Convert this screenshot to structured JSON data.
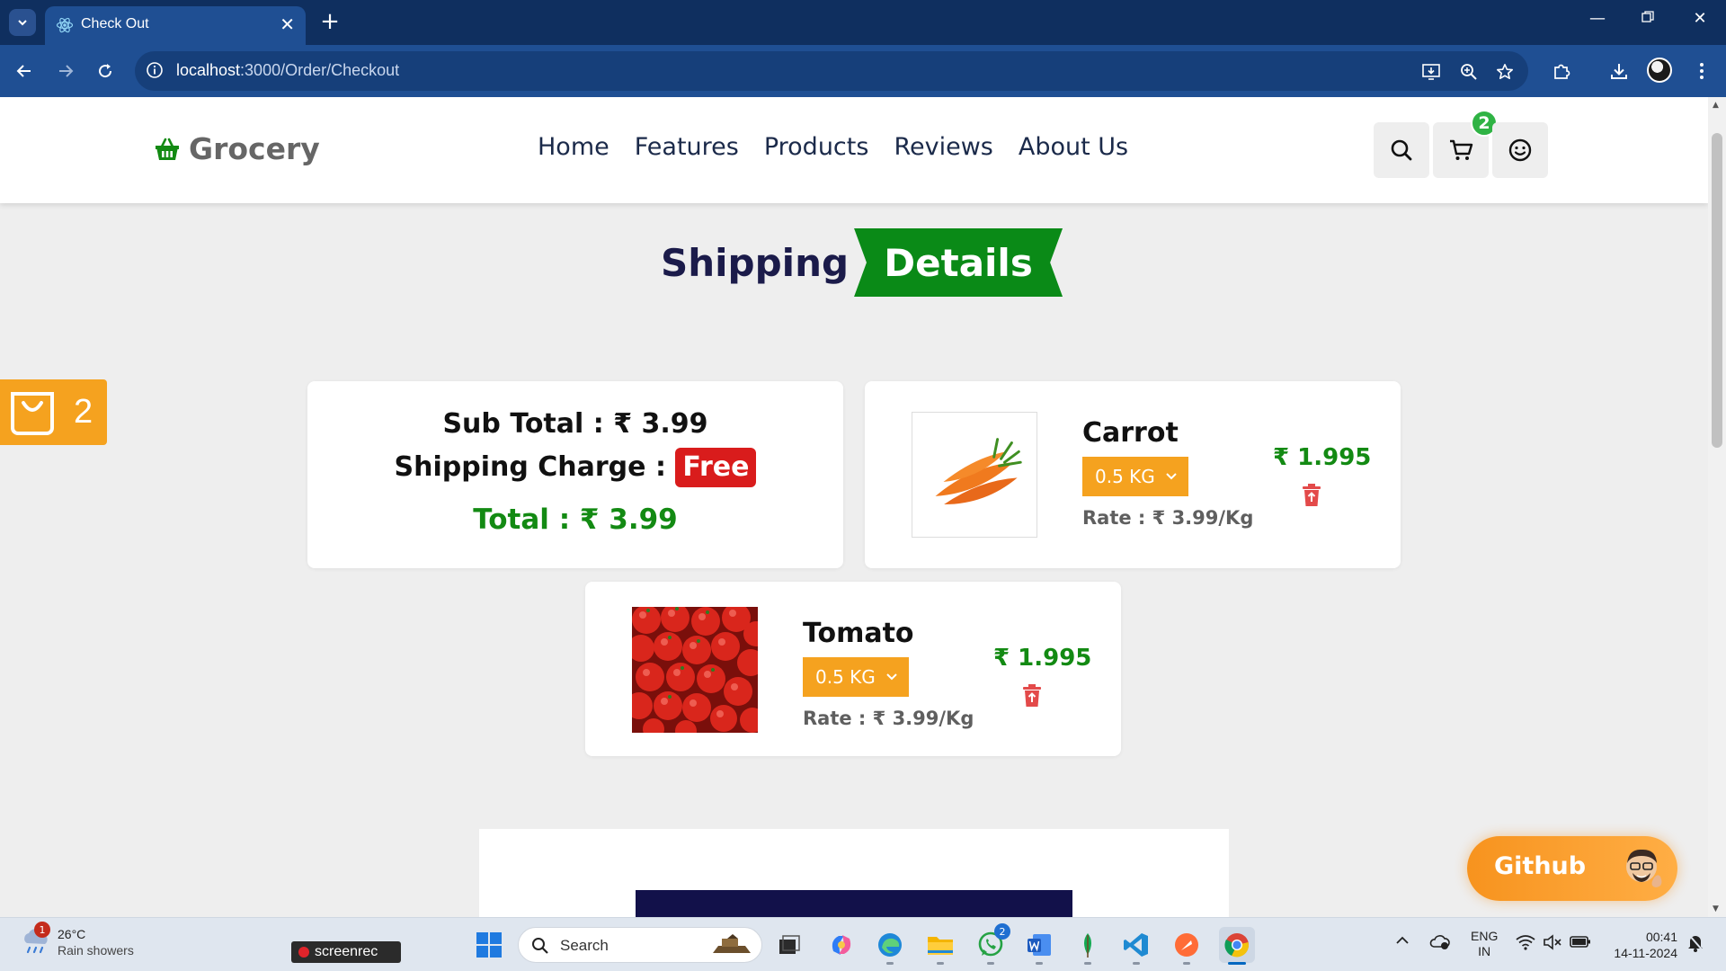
{
  "browser": {
    "tab_title": "Check Out",
    "url_host": "localhost",
    "url_path": ":3000/Order/Checkout"
  },
  "site": {
    "logo_text": "Grocery",
    "nav": [
      "Home",
      "Features",
      "Products",
      "Reviews",
      "About Us"
    ],
    "cart_count": "2",
    "side_cart_count": "2"
  },
  "heading": {
    "part1": "Shipping",
    "part2": "Details"
  },
  "summary": {
    "subtotal_label": "Sub Total : ",
    "subtotal_value": "₹ 3.99",
    "shipping_label": "Shipping Charge : ",
    "shipping_value": "Free",
    "total_label": "Total : ",
    "total_value": "₹ 3.99"
  },
  "items": [
    {
      "name": "Carrot",
      "qty": "0.5 KG",
      "rate": "Rate : ₹ 3.99/Kg",
      "price": "₹ 1.995"
    },
    {
      "name": "Tomato",
      "qty": "0.5 KG",
      "rate": "Rate : ₹ 3.99/Kg",
      "price": "₹ 1.995"
    }
  ],
  "github_label": "Github",
  "taskbar": {
    "weather_temp": "26°C",
    "weather_desc": "Rain showers",
    "weather_badge": "1",
    "screenrec": "screenrec",
    "search_placeholder": "Search",
    "whatsapp_badge": "2",
    "lang_line1": "ENG",
    "lang_line2": "IN",
    "time": "00:41",
    "date": "14-11-2024"
  },
  "colors": {
    "accent_orange": "#f5a21f",
    "accent_green": "#138a13",
    "ribbon_green": "#0a8a17",
    "free_red": "#d91c1c",
    "heading_navy": "#1b1b4a"
  }
}
